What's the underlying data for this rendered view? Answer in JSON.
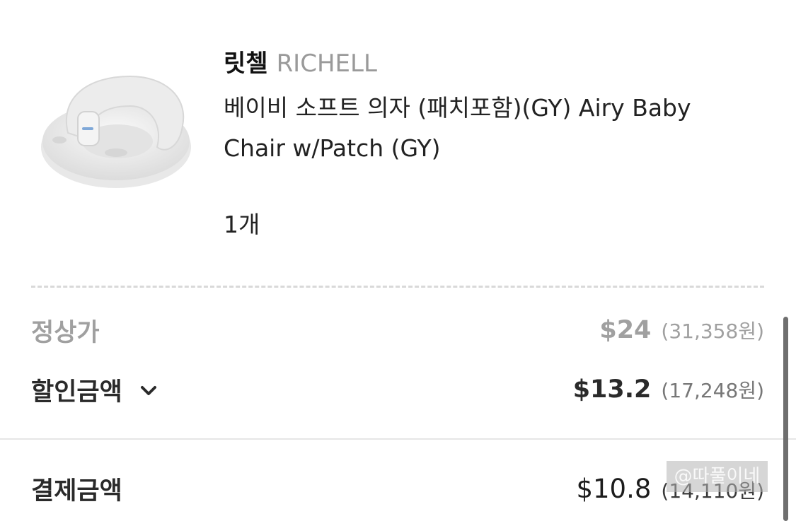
{
  "product": {
    "brand_kr": "릿첼",
    "brand_en": "RICHELL",
    "name": "베이비 소프트 의자 (패치포함)(GY) Airy Baby Chair w/Patch (GY)",
    "quantity": "1개",
    "thumbnail_icon": "baby-chair-image"
  },
  "prices": {
    "list": {
      "label": "정상가",
      "usd": "$24",
      "krw": "(31,358원)"
    },
    "discount": {
      "label": "할인금액",
      "usd": "$13.2",
      "krw": "(17,248원)",
      "toggle_icon": "chevron-down-icon"
    },
    "total": {
      "label": "결제금액",
      "usd": "$10.8",
      "krw": "(14,110원)"
    }
  },
  "watermark": "@따풀이네",
  "colors": {
    "muted": "#a0a0a0",
    "text": "#1c1c1c",
    "divider": "#d9d9d9"
  }
}
